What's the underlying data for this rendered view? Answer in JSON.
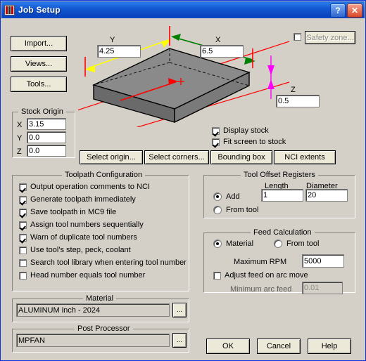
{
  "window": {
    "title": "Job Setup",
    "help_button": "?",
    "close_button": "✕"
  },
  "left_buttons": [
    {
      "label": "Import..."
    },
    {
      "label": "Views..."
    },
    {
      "label": "Tools..."
    }
  ],
  "safety_zone": {
    "label": "Safety zone...",
    "checked": false,
    "enabled": false
  },
  "stock_dimensions": {
    "y_label": "Y",
    "y_value": "4.25",
    "x_label": "X",
    "x_value": "6.5",
    "z_label": "Z",
    "z_value": "0.5"
  },
  "stock_origin": {
    "title": "Stock Origin",
    "rows": [
      {
        "axis": "X",
        "value": "3.15"
      },
      {
        "axis": "Y",
        "value": "0.0"
      },
      {
        "axis": "Z",
        "value": "0.0"
      }
    ]
  },
  "display_options": [
    {
      "label": "Display stock",
      "checked": true
    },
    {
      "label": "Fit screen to stock",
      "checked": true
    }
  ],
  "action_buttons": [
    {
      "label": "Select origin..."
    },
    {
      "label": "Select corners..."
    },
    {
      "label": "Bounding box"
    },
    {
      "label": "NCI extents"
    }
  ],
  "toolpath_configuration": {
    "title": "Toolpath Configuration",
    "items": [
      {
        "label": "Output operation comments to NCI",
        "checked": true
      },
      {
        "label": "Generate toolpath immediately",
        "checked": true
      },
      {
        "label": "Save toolpath in MC9 file",
        "checked": true
      },
      {
        "label": "Assign tool numbers sequentially",
        "checked": true
      },
      {
        "label": "Warn of duplicate tool numbers",
        "checked": true
      },
      {
        "label": "Use tool's step, peck, coolant",
        "checked": false
      },
      {
        "label": "Search tool library when entering tool number",
        "checked": false
      },
      {
        "label": "Head number equals tool number",
        "checked": false
      }
    ]
  },
  "tool_offset_registers": {
    "title": "Tool Offset Registers",
    "length_label": "Length",
    "diameter_label": "Diameter",
    "length_value": "1",
    "diameter_value": "20",
    "options": [
      {
        "label": "Add",
        "selected": true
      },
      {
        "label": "From tool",
        "selected": false
      }
    ]
  },
  "feed_calculation": {
    "title": "Feed Calculation",
    "options": [
      {
        "label": "Material",
        "selected": true
      },
      {
        "label": "From tool",
        "selected": false
      }
    ],
    "max_rpm_label": "Maximum RPM",
    "max_rpm_value": "5000",
    "adjust_feed_label": "Adjust feed on arc move",
    "adjust_feed_checked": false,
    "min_arc_feed_label": "Minimum arc feed",
    "min_arc_feed_value": "0.01"
  },
  "material": {
    "title": "Material",
    "value": "ALUMINUM inch - 2024",
    "browse_label": "..."
  },
  "post_processor": {
    "title": "Post Processor",
    "value": "MPFAN",
    "browse_label": "..."
  },
  "dialog_buttons": [
    {
      "label": "OK"
    },
    {
      "label": "Cancel"
    },
    {
      "label": "Help"
    }
  ],
  "colors": {
    "titlebar": "#0a43bd",
    "dialog_face": "#d4d0c8",
    "axis_red": "#ff0000",
    "dim_yellow": "#ffff00",
    "dim_green": "#008000",
    "dim_magenta": "#ff00ff",
    "stock_top": "#808080",
    "stock_front": "#6e6e6e"
  }
}
